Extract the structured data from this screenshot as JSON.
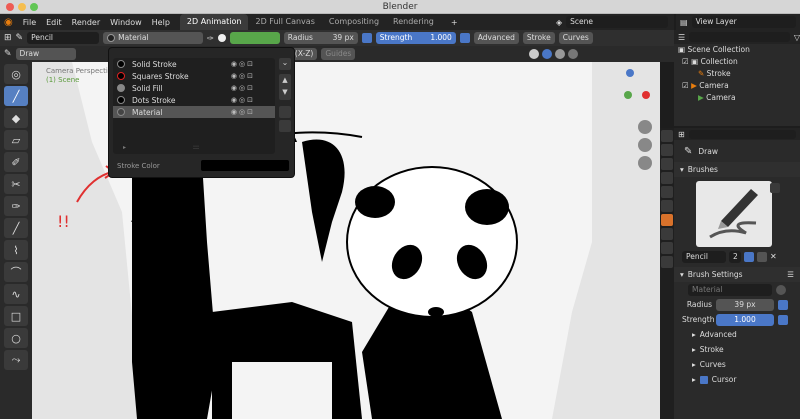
{
  "window": {
    "title": "Blender"
  },
  "menus": [
    "File",
    "Edit",
    "Render",
    "Window",
    "Help"
  ],
  "workspace_tabs": [
    {
      "label": "2D Animation",
      "active": true
    },
    {
      "label": "2D Full Canvas",
      "active": false
    },
    {
      "label": "Compositing",
      "active": false
    },
    {
      "label": "Rendering",
      "active": false
    }
  ],
  "add_tab_label": "+",
  "scene": {
    "value": "Scene"
  },
  "view_layer": {
    "value": "View Layer"
  },
  "header": {
    "brush_name": "Pencil",
    "material_name": "Material",
    "radius_label": "Radius",
    "radius_value": "39 px",
    "strength_label": "Strength",
    "strength_value": "1.000",
    "advanced": "Advanced",
    "stroke": "Stroke",
    "curves": "Curves"
  },
  "header2": {
    "mode": "Draw",
    "orientation": "Front (X-Z)",
    "guides": "Guides"
  },
  "viewport": {
    "camera_label": "Camera Perspective",
    "frame_label": "(1) Scene"
  },
  "material_popover": {
    "items": [
      {
        "name": "Solid Stroke",
        "color": "#000000",
        "ring": "#888888"
      },
      {
        "name": "Squares Stroke",
        "color": "#000000",
        "ring": "#e02020"
      },
      {
        "name": "Solid Fill",
        "color": "#888888",
        "ring": "#888888"
      },
      {
        "name": "Dots Stroke",
        "color": "#000000",
        "ring": "#888888"
      },
      {
        "name": "Material",
        "color": "#444444",
        "ring": "#888888"
      }
    ],
    "selected": "Material",
    "stroke_color_label": "Stroke Color"
  },
  "outliner": {
    "items": [
      {
        "label": "Scene Collection",
        "indent": 0
      },
      {
        "label": "Collection",
        "indent": 1
      },
      {
        "label": "Stroke",
        "indent": 2
      },
      {
        "label": "Camera",
        "indent": 1
      },
      {
        "label": "Camera",
        "indent": 2
      }
    ]
  },
  "properties": {
    "tool_name": "Draw",
    "brushes_section": "Brushes",
    "brush_name": "Pencil",
    "brush_users": "2",
    "brush_settings_section": "Brush Settings",
    "material_placeholder": "Material",
    "radius_label": "Radius",
    "radius_value": "39 px",
    "strength_label": "Strength",
    "strength_value": "1.000",
    "subpanels": [
      "Advanced",
      "Stroke",
      "Curves",
      "Cursor"
    ]
  },
  "annotation": {
    "text": "!!",
    "color": "#e03030"
  },
  "colors": {
    "accent": "#4a77c7",
    "active_tab": "#d9722b"
  }
}
